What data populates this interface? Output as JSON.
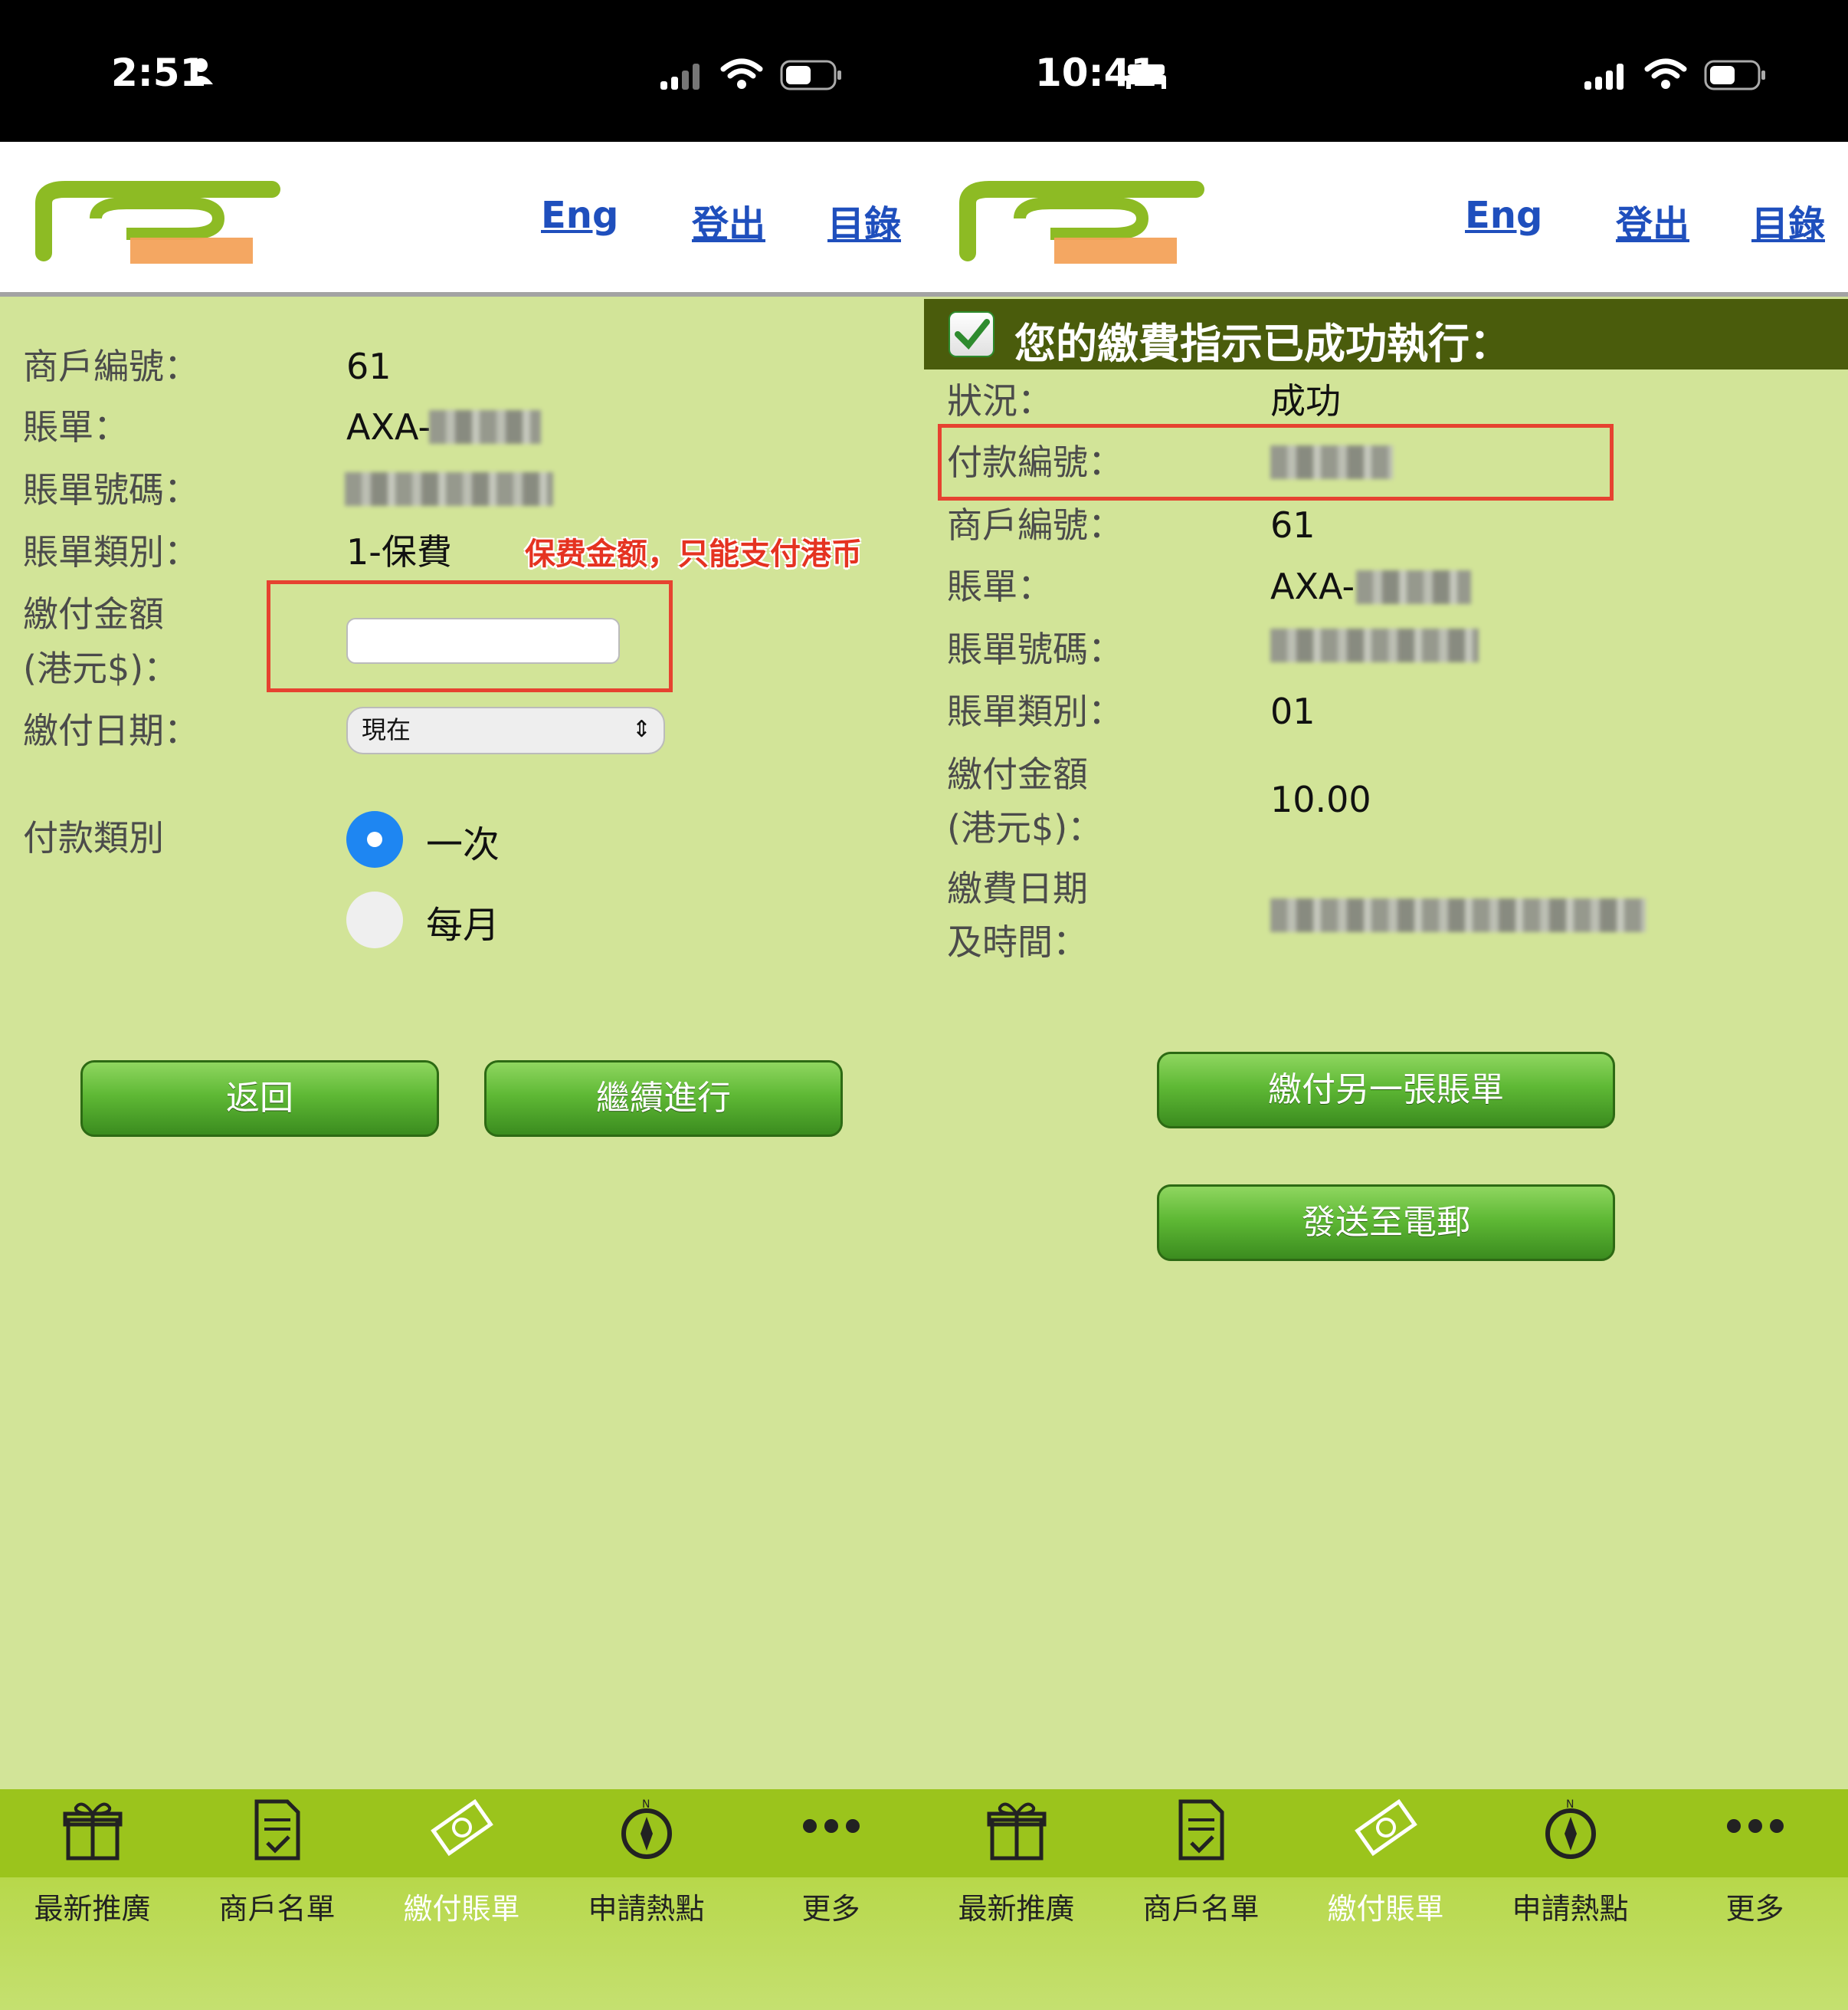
{
  "left": {
    "status": {
      "time": "2:51"
    },
    "header": {
      "eng": "Eng",
      "logout": "登出",
      "menu": "目錄"
    },
    "form": {
      "merchant_label": "商戶編號：",
      "merchant_value": "61",
      "bill_label": "賬單：",
      "bill_value": "AXA-",
      "bill_no_label": "賬單號碼：",
      "bill_type_label": "賬單類別：",
      "bill_type_value": "1-保費",
      "amount_label_1": "繳付金額",
      "amount_label_2": "(港元$)：",
      "date_label": "繳付日期：",
      "date_value": "現在",
      "pay_type_label": "付款類別",
      "option_once": "一次",
      "option_monthly": "每月"
    },
    "annotation": "保费金额，只能支付港币",
    "buttons": {
      "back": "返回",
      "continue": "繼續進行"
    }
  },
  "right": {
    "status": {
      "time": "10:41"
    },
    "header": {
      "eng": "Eng",
      "logout": "登出",
      "menu": "目錄"
    },
    "banner": "您的繳費指示已成功執行：",
    "details": {
      "status_label": "狀況：",
      "status_value": "成功",
      "payment_no_label": "付款編號：",
      "merchant_label": "商戶編號：",
      "merchant_value": "61",
      "bill_label": "賬單：",
      "bill_value": "AXA-",
      "bill_no_label": "賬單號碼：",
      "bill_type_label": "賬單類別：",
      "bill_type_value": "01",
      "amount_label_1": "繳付金額",
      "amount_label_2": "(港元$)：",
      "amount_value": "10.00",
      "datetime_label_1": "繳費日期",
      "datetime_label_2": "及時間："
    },
    "buttons": {
      "pay_another": "繳付另一張賬單",
      "send_email": "發送至電郵"
    }
  },
  "tabs": [
    {
      "label": "最新推廣",
      "icon": "gift-icon"
    },
    {
      "label": "商戶名單",
      "icon": "document-list-icon"
    },
    {
      "label": "繳付賬單",
      "icon": "bill-payment-icon"
    },
    {
      "label": "申請熱點",
      "icon": "compass-icon"
    },
    {
      "label": "更多",
      "icon": "more-dots-icon"
    }
  ],
  "colors": {
    "page_bg": "#d2e498",
    "tab_bar": "#9bc41c",
    "banner": "#4a5c0c",
    "link": "#1f4fbd",
    "annotation_red": "#e53321"
  }
}
